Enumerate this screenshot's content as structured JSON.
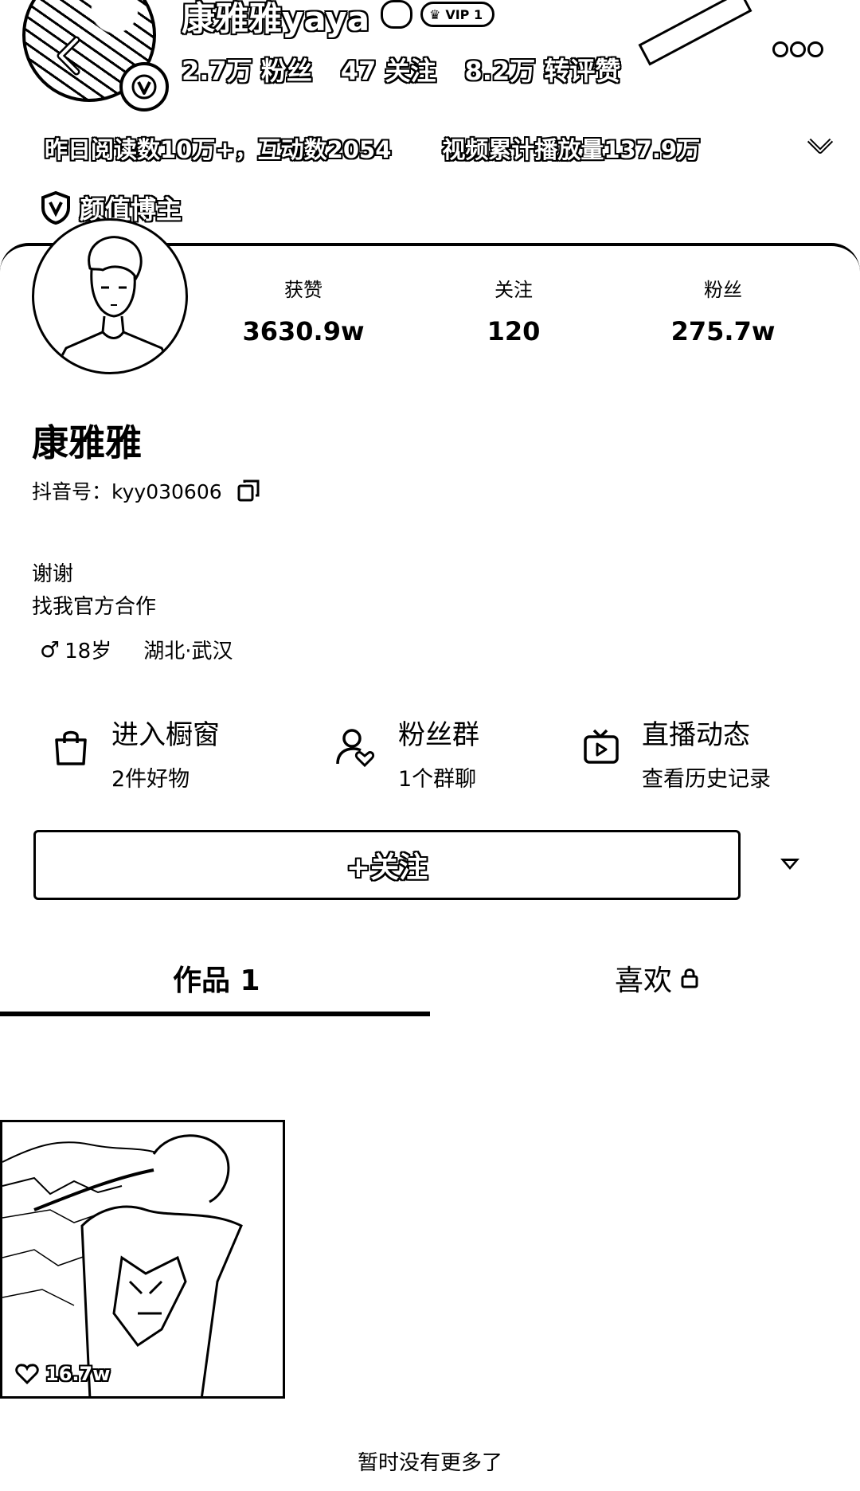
{
  "banner": {
    "name": "康雅雅yaya",
    "vip_label": "VIP 1",
    "stats": [
      "2.7万 粉丝",
      "47 关注",
      "8.2万 转评赞"
    ],
    "info_items": [
      "昨日阅读数10万+，互动数2054",
      "视频累计播放量137.9万"
    ],
    "tag": "颜值博主"
  },
  "profile": {
    "stats": [
      {
        "label": "获赞",
        "value": "3630.9w"
      },
      {
        "label": "关注",
        "value": "120"
      },
      {
        "label": "粉丝",
        "value": "275.7w"
      }
    ],
    "name": "康雅雅",
    "id_prefix": "抖音号：",
    "id_value": "kyy030606",
    "bio_line1": "谢谢",
    "bio_line2": "找我官方合作",
    "gender_symbol": "♂",
    "age": "18岁",
    "location": "湖北·武汉"
  },
  "entries": [
    {
      "title": "进入橱窗",
      "subtitle": "2件好物",
      "icon": "shopping-bag-icon"
    },
    {
      "title": "粉丝群",
      "subtitle": "1个群聊",
      "icon": "fan-group-icon"
    },
    {
      "title": "直播动态",
      "subtitle": "查看历史记录",
      "icon": "live-tv-icon"
    }
  ],
  "follow_button": "+关注",
  "tabs": {
    "works": "作品 1",
    "likes": "喜欢"
  },
  "video": {
    "likes": "16.7w"
  },
  "footer": "暂时没有更多了"
}
